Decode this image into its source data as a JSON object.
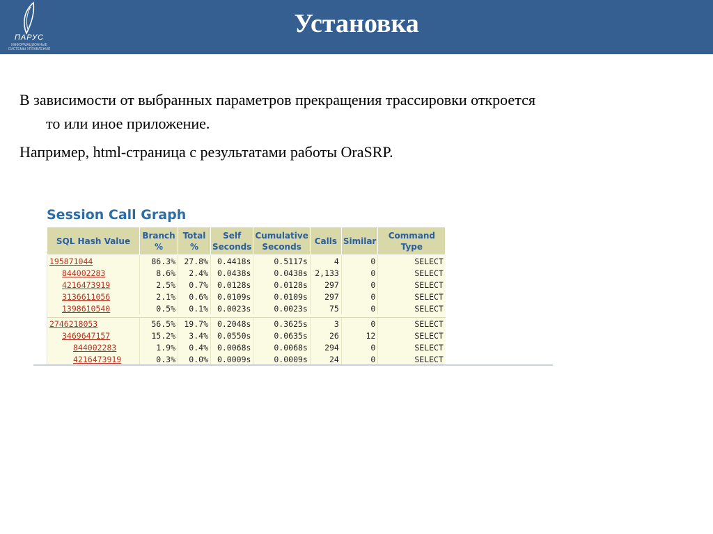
{
  "header": {
    "title": "Установка",
    "logo_text": "ПАРУС",
    "logo_subtext": "ИНФОРМАЦИОННЫЕ СИСТЕМЫ УПРАВЛЕНИЯ"
  },
  "body": {
    "paragraph1_line1": "В зависимости от выбранных параметров прекращения трассировки откроется",
    "paragraph1_line2": "то или иное приложение.",
    "paragraph2": "Например, html-страница с результатами работы OraSRP."
  },
  "screenshot": {
    "section_title": "Session Call Graph",
    "columns": [
      "SQL Hash Value",
      "Branch %",
      "Total %",
      "Self Seconds",
      "Cumulative Seconds",
      "Calls",
      "Similar",
      "Command Type"
    ],
    "rows": [
      {
        "hash": "195871044",
        "branch": "86.3%",
        "total": "27.8%",
        "self": "0.4418s",
        "cumulative": "0.5117s",
        "calls": "4",
        "similar": "0",
        "command": "SELECT"
      },
      {
        "hash": "844002283",
        "branch": "8.6%",
        "total": "2.4%",
        "self": "0.0438s",
        "cumulative": "0.0438s",
        "calls": "2,133",
        "similar": "0",
        "command": "SELECT"
      },
      {
        "hash": "4216473919",
        "branch": "2.5%",
        "total": "0.7%",
        "self": "0.0128s",
        "cumulative": "0.0128s",
        "calls": "297",
        "similar": "0",
        "command": "SELECT"
      },
      {
        "hash": "3136611056",
        "branch": "2.1%",
        "total": "0.6%",
        "self": "0.0109s",
        "cumulative": "0.0109s",
        "calls": "297",
        "similar": "0",
        "command": "SELECT"
      },
      {
        "hash": "1398610540",
        "branch": "0.5%",
        "total": "0.1%",
        "self": "0.0023s",
        "cumulative": "0.0023s",
        "calls": "75",
        "similar": "0",
        "command": "SELECT"
      },
      {
        "hash": "2746218053",
        "branch": "56.5%",
        "total": "19.7%",
        "self": "0.2048s",
        "cumulative": "0.3625s",
        "calls": "3",
        "similar": "0",
        "command": "SELECT"
      },
      {
        "hash": "3469647157",
        "branch": "15.2%",
        "total": "3.4%",
        "self": "0.0550s",
        "cumulative": "0.0635s",
        "calls": "26",
        "similar": "12",
        "command": "SELECT"
      },
      {
        "hash": "844002283",
        "branch": "1.9%",
        "total": "0.4%",
        "self": "0.0068s",
        "cumulative": "0.0068s",
        "calls": "294",
        "similar": "0",
        "command": "SELECT"
      },
      {
        "hash": "4216473919",
        "branch": "0.3%",
        "total": "0.0%",
        "self": "0.0009s",
        "cumulative": "0.0009s",
        "calls": "24",
        "similar": "0",
        "command": "SELECT"
      }
    ]
  },
  "colors": {
    "header_bg": "#365f91",
    "table_header_bg": "#d8d8a8",
    "table_row_bg": "#fbfbe4",
    "link": "#b5311f",
    "section_title": "#2e6da4"
  }
}
